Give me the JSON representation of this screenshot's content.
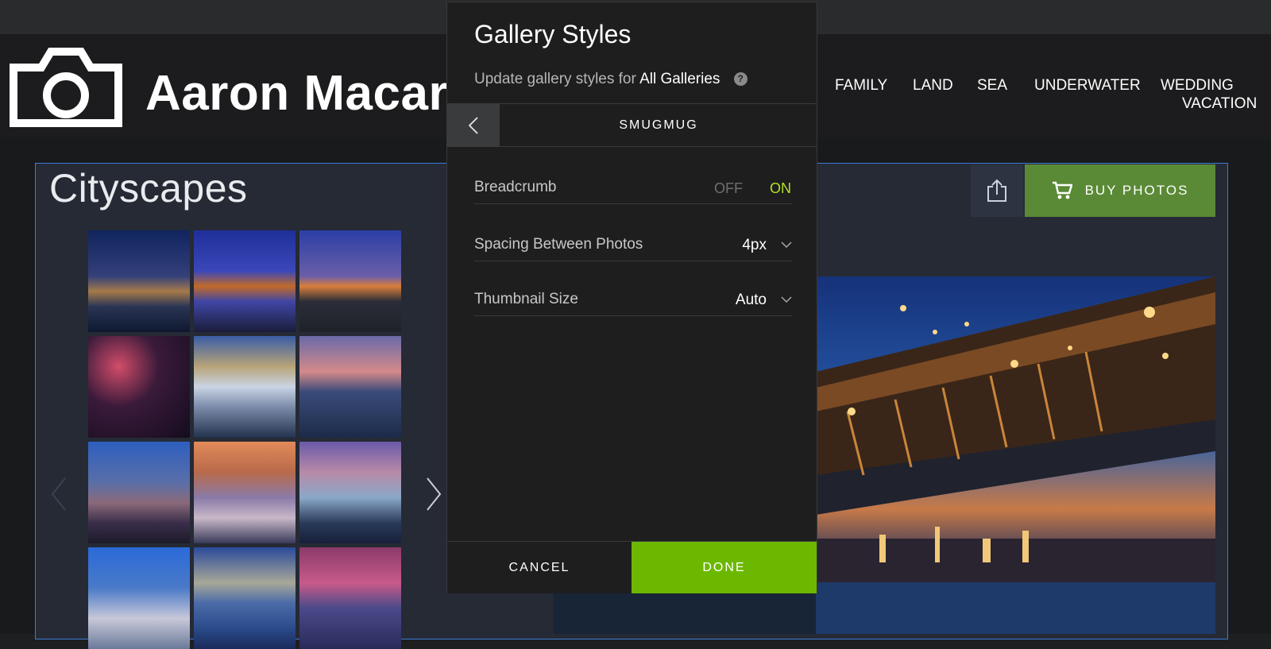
{
  "site": {
    "title": "Aaron Macar",
    "nav": [
      "FAMILY",
      "LAND",
      "SEA",
      "UNDERWATER",
      "WEDDING",
      "VACATION"
    ]
  },
  "gallery": {
    "title": "Cityscapes",
    "buy_label": "BUY PHOTOS"
  },
  "modal": {
    "title": "Gallery Styles",
    "subtitle_prefix": "Update gallery styles for",
    "subtitle_target": "All Galleries",
    "help_glyph": "?",
    "nav_title": "SMUGMUG",
    "breadcrumb": {
      "label": "Breadcrumb",
      "off": "OFF",
      "on": "ON",
      "selected": "ON"
    },
    "spacing": {
      "label": "Spacing Between Photos",
      "value": "4px"
    },
    "thumbnail": {
      "label": "Thumbnail Size",
      "value": "Auto"
    },
    "cancel_label": "CANCEL",
    "done_label": "DONE"
  },
  "colors": {
    "done": "#6cb800",
    "on": "#b2e32a",
    "buy": "#5a8a36",
    "selection_border": "#3d7bd8"
  },
  "icons": [
    "camera-logo-icon",
    "share-icon",
    "cart-icon",
    "chevron-left-icon",
    "chevron-right-icon",
    "chevron-down-icon",
    "help-icon"
  ]
}
